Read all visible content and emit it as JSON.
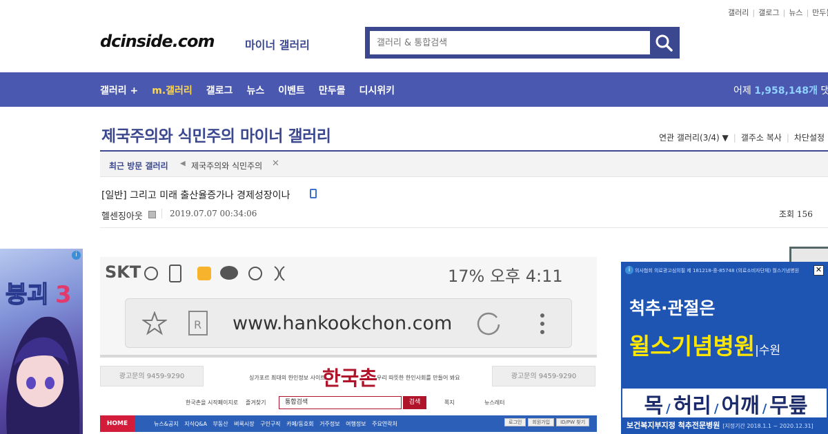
{
  "top_links": [
    "갤러리",
    "갤로그",
    "뉴스",
    "만두몰"
  ],
  "logo": {
    "main": "dcinside.com",
    "sub": "마이너 갤러리"
  },
  "search": {
    "placeholder": "갤러리 & 통합검색"
  },
  "nav": {
    "items": [
      "갤러리 +",
      "m.갤러리",
      "갤로그",
      "뉴스",
      "이벤트",
      "만두몰",
      "디시위키"
    ],
    "count_prefix": "어제",
    "count_value": "1,958,148개",
    "count_suffix": "댓글"
  },
  "gallery": {
    "title": "제국주의와 식민주의 마이너 갤러리",
    "tools": [
      "연관 갤러리(3/4)",
      "갤주소 복사",
      "차단설정"
    ]
  },
  "recent": {
    "label": "최근 방문 갤러리",
    "item": "제국주의와 식민주의"
  },
  "post": {
    "title": "[일반] 그리고 미래 출산율증가나 경제성장이나",
    "author": "헬센징아웃",
    "date": "2019.07.07 00:34:06",
    "views_label": "조회",
    "views": "156"
  },
  "screenshot": {
    "carrier": "SKT",
    "status_right": "17%  오후 4:11",
    "url": "www.hankookchon.com",
    "ad_left": "광고문의 9459-9290",
    "ad_right": "광고문의 9459-9290",
    "logo": "한국촌",
    "slogan_left": "싱가포르 최대의 한인정보 사이트",
    "slogan_right": "우리 따뜻한 한인사회를 만들어 봐요",
    "search_placeholder": "통합검색",
    "search_btn": "검색",
    "link1": "한국촌을 시작페이지로",
    "link2": "즐겨찾기",
    "link3": "쪽지",
    "link4": "뉴스레터",
    "home": "HOME",
    "menu": "뉴스&공지 지식Q&A 부동산 벼룩시장 구인구직 카페/동호회 거주정보 여행정보 주요연락처",
    "menu_btns": [
      "로그인",
      "회원가입",
      "ID/PW 찾기"
    ]
  },
  "right_ad": {
    "topbar": "의사협회 의료광고심의필 제 181218-중-85748                    (의료소비자단체) 월스기념병원",
    "line1": "척추·관절은",
    "line2": "윌스기념병원",
    "line2_suffix": "|수원",
    "parts": [
      "목",
      "허리",
      "어깨",
      "무릎"
    ],
    "footer": "보건복지부지정 척추전문병원",
    "footer_note": "[지정기간 2018.1.1 ~ 2020.12.31]"
  },
  "colors": {
    "brand": "#3b4890",
    "nav_bg": "#4a58b0",
    "highlight": "#ffd74a"
  }
}
